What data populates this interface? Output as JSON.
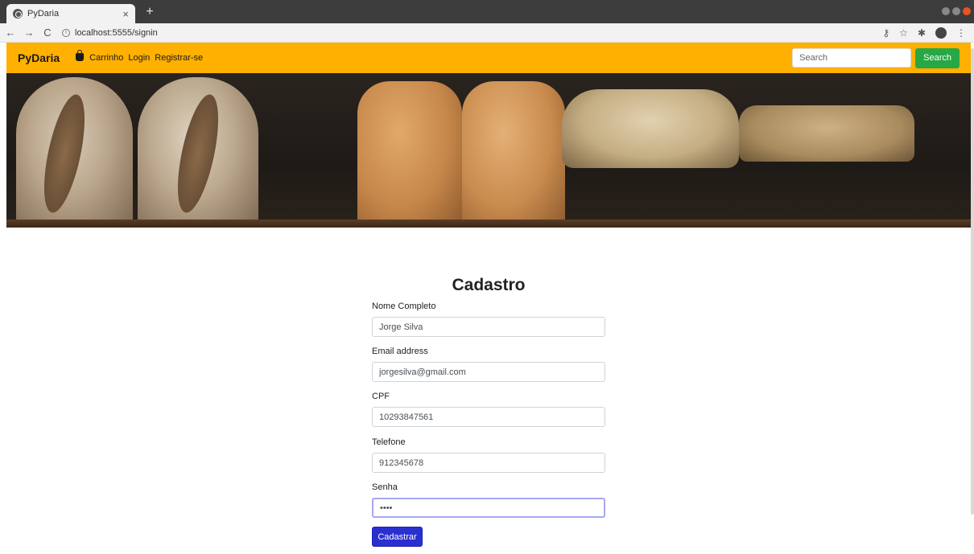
{
  "browser": {
    "tab_title": "PyDaria",
    "tab_close": "×",
    "new_tab": "+",
    "url": "localhost:5555/signin"
  },
  "navbar": {
    "brand": "PyDaria",
    "links": [
      "Carrinho",
      "Login",
      "Registrar-se"
    ],
    "search_placeholder": "Search",
    "search_button": "Search",
    "color": "#ffb000"
  },
  "form": {
    "title": "Cadastro",
    "fields": [
      {
        "label": "Nome Completo",
        "value": "Jorge Silva"
      },
      {
        "label": "Email address",
        "value": "jorgesilva@gmail.com"
      },
      {
        "label": "CPF",
        "value": "10293847561"
      },
      {
        "label": "Telefone",
        "value": "912345678"
      },
      {
        "label": "Senha",
        "value": "••••"
      }
    ],
    "submit_label": "Cadastrar"
  },
  "colors": {
    "search_button": "#28a745",
    "submit_button": "#2a2fd0"
  }
}
